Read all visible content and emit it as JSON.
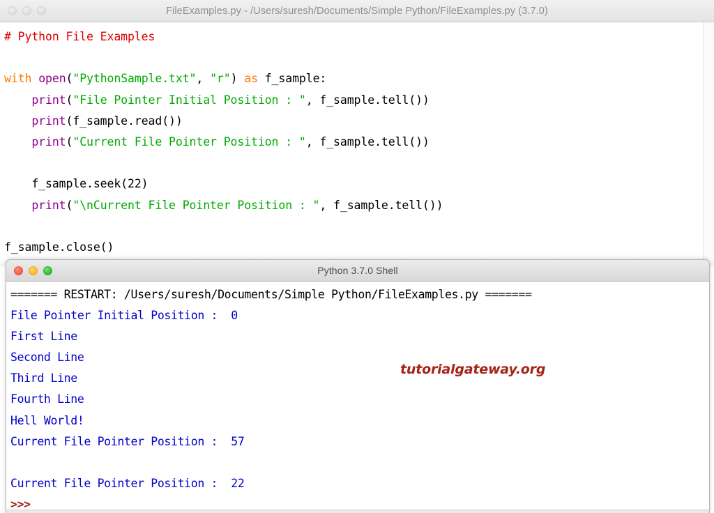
{
  "editor": {
    "title": "FileExamples.py - /Users/suresh/Documents/Simple Python/FileExamples.py (3.7.0)",
    "traffic_lights": [
      "close",
      "minimize",
      "zoom"
    ],
    "code_lines": [
      [
        {
          "t": "comment",
          "s": "# Python File Examples"
        }
      ],
      [],
      [
        {
          "t": "keyword",
          "s": "with"
        },
        {
          "t": "plain",
          "s": " "
        },
        {
          "t": "builtin",
          "s": "open"
        },
        {
          "t": "plain",
          "s": "("
        },
        {
          "t": "string",
          "s": "\"PythonSample.txt\""
        },
        {
          "t": "plain",
          "s": ", "
        },
        {
          "t": "string",
          "s": "\"r\""
        },
        {
          "t": "plain",
          "s": ") "
        },
        {
          "t": "keyword",
          "s": "as"
        },
        {
          "t": "plain",
          "s": " f_sample:"
        }
      ],
      [
        {
          "t": "plain",
          "s": "    "
        },
        {
          "t": "builtin",
          "s": "print"
        },
        {
          "t": "plain",
          "s": "("
        },
        {
          "t": "string",
          "s": "\"File Pointer Initial Position : \""
        },
        {
          "t": "plain",
          "s": ", f_sample.tell())"
        }
      ],
      [
        {
          "t": "plain",
          "s": "    "
        },
        {
          "t": "builtin",
          "s": "print"
        },
        {
          "t": "plain",
          "s": "(f_sample.read())"
        }
      ],
      [
        {
          "t": "plain",
          "s": "    "
        },
        {
          "t": "builtin",
          "s": "print"
        },
        {
          "t": "plain",
          "s": "("
        },
        {
          "t": "string",
          "s": "\"Current File Pointer Position : \""
        },
        {
          "t": "plain",
          "s": ", f_sample.tell())"
        }
      ],
      [],
      [
        {
          "t": "plain",
          "s": "    f_sample.seek(22)"
        }
      ],
      [
        {
          "t": "plain",
          "s": "    "
        },
        {
          "t": "builtin",
          "s": "print"
        },
        {
          "t": "plain",
          "s": "("
        },
        {
          "t": "string",
          "s": "\"\\nCurrent File Pointer Position : \""
        },
        {
          "t": "plain",
          "s": ", f_sample.tell())"
        }
      ],
      [],
      [
        {
          "t": "plain",
          "s": "f_sample.close()"
        }
      ]
    ]
  },
  "shell": {
    "title": "Python 3.7.0 Shell",
    "traffic_lights": [
      "close",
      "minimize",
      "zoom"
    ],
    "output_lines": [
      {
        "style": "restart",
        "text": "======= RESTART: /Users/suresh/Documents/Simple Python/FileExamples.py ======="
      },
      {
        "style": "output",
        "text": "File Pointer Initial Position :  0"
      },
      {
        "style": "output",
        "text": "First Line"
      },
      {
        "style": "output",
        "text": "Second Line"
      },
      {
        "style": "output",
        "text": "Third Line"
      },
      {
        "style": "output",
        "text": "Fourth Line"
      },
      {
        "style": "output",
        "text": "Hell World!"
      },
      {
        "style": "output",
        "text": "Current File Pointer Position :  57"
      },
      {
        "style": "output",
        "text": ""
      },
      {
        "style": "output",
        "text": "Current File Pointer Position :  22"
      },
      {
        "style": "prompt",
        "text": ">>>"
      }
    ]
  },
  "watermark": {
    "text": "tutorialgateway.org",
    "color": "#a62316"
  },
  "colors": {
    "comment": "#dd0000",
    "keyword": "#ff7700",
    "builtin": "#900090",
    "string": "#00aa00",
    "shell_output": "#0000cc",
    "shell_prompt": "#992222"
  }
}
